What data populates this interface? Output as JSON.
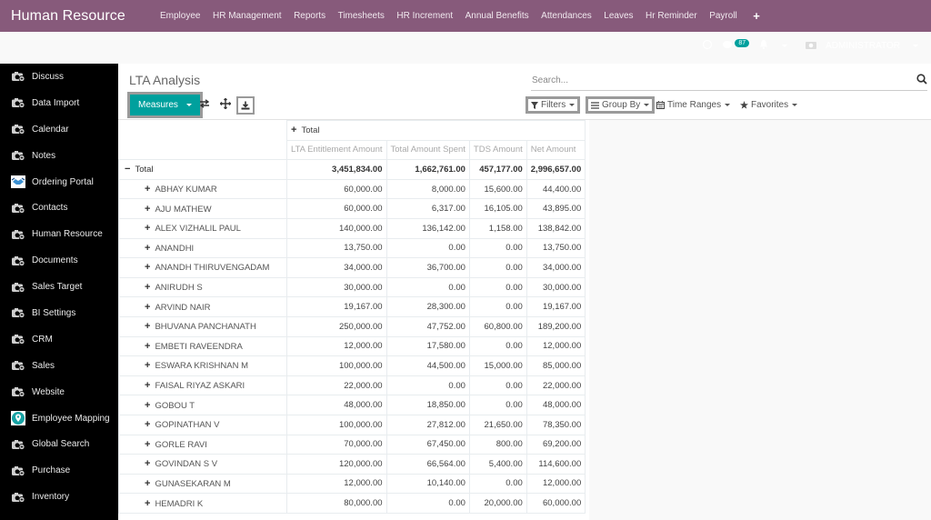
{
  "app": {
    "title": "Human Resource",
    "menu": [
      "Employee",
      "HR Management",
      "Reports",
      "Timesheets",
      "HR Increment",
      "Annual Benefits",
      "Attendances",
      "Leaves",
      "Hr Reminder",
      "Payroll"
    ],
    "add_icon": "plus-icon"
  },
  "systray": {
    "chat_count": "87",
    "user": "ADMINISTRATOR"
  },
  "sidebar": {
    "items": [
      {
        "label": "Discuss",
        "icon": "app-camera-icon"
      },
      {
        "label": "Data Import",
        "icon": "app-camera-icon"
      },
      {
        "label": "Calendar",
        "icon": "app-camera-icon"
      },
      {
        "label": "Notes",
        "icon": "app-camera-icon"
      },
      {
        "label": "Ordering Portal",
        "icon": "handshake-icon"
      },
      {
        "label": "Contacts",
        "icon": "app-camera-icon"
      },
      {
        "label": "Human Resource",
        "icon": "app-camera-icon"
      },
      {
        "label": "Documents",
        "icon": "app-camera-icon"
      },
      {
        "label": "Sales Target",
        "icon": "app-camera-icon"
      },
      {
        "label": "BI Settings",
        "icon": "app-camera-icon"
      },
      {
        "label": "CRM",
        "icon": "app-camera-icon"
      },
      {
        "label": "Sales",
        "icon": "app-camera-icon"
      },
      {
        "label": "Website",
        "icon": "app-camera-icon"
      },
      {
        "label": "Employee Mapping",
        "icon": "map-pin-icon"
      },
      {
        "label": "Global Search",
        "icon": "app-camera-icon"
      },
      {
        "label": "Purchase",
        "icon": "app-camera-icon"
      },
      {
        "label": "Inventory",
        "icon": "app-camera-icon"
      }
    ]
  },
  "control_panel": {
    "title": "LTA Analysis",
    "measures_label": "Measures",
    "search_placeholder": "Search...",
    "filters_label": "Filters",
    "groupby_label": "Group By",
    "timeranges_label": "Time Ranges",
    "favorites_label": "Favorites"
  },
  "pivot": {
    "col_group": "Total",
    "row_group": "Total",
    "measures": [
      "LTA Entitlement Amount",
      "Total Amount Spent",
      "TDS Amount",
      "Net Amount"
    ],
    "totals": [
      "3,451,834.00",
      "1,662,761.00",
      "457,177.00",
      "2,996,657.00"
    ],
    "rows": [
      {
        "name": "ABHAY KUMAR",
        "values": [
          "60,000.00",
          "8,000.00",
          "15,600.00",
          "44,400.00"
        ]
      },
      {
        "name": "AJU MATHEW",
        "values": [
          "60,000.00",
          "6,317.00",
          "16,105.00",
          "43,895.00"
        ]
      },
      {
        "name": "ALEX VIZHALIL PAUL",
        "values": [
          "140,000.00",
          "136,142.00",
          "1,158.00",
          "138,842.00"
        ]
      },
      {
        "name": "ANANDHI",
        "values": [
          "13,750.00",
          "0.00",
          "0.00",
          "13,750.00"
        ]
      },
      {
        "name": "ANANDH THIRUVENGADAM",
        "values": [
          "34,000.00",
          "36,700.00",
          "0.00",
          "34,000.00"
        ]
      },
      {
        "name": "ANIRUDH S",
        "values": [
          "30,000.00",
          "0.00",
          "0.00",
          "30,000.00"
        ]
      },
      {
        "name": "ARVIND NAIR",
        "values": [
          "19,167.00",
          "28,300.00",
          "0.00",
          "19,167.00"
        ]
      },
      {
        "name": "BHUVANA PANCHANATH",
        "values": [
          "250,000.00",
          "47,752.00",
          "60,800.00",
          "189,200.00"
        ]
      },
      {
        "name": "EMBETI RAVEENDRA",
        "values": [
          "12,000.00",
          "17,580.00",
          "0.00",
          "12,000.00"
        ]
      },
      {
        "name": "ESWARA KRISHNAN M",
        "values": [
          "100,000.00",
          "44,500.00",
          "15,000.00",
          "85,000.00"
        ]
      },
      {
        "name": "FAISAL RIYAZ ASKARI",
        "values": [
          "22,000.00",
          "0.00",
          "0.00",
          "22,000.00"
        ]
      },
      {
        "name": "GOBOU T",
        "values": [
          "48,000.00",
          "18,850.00",
          "0.00",
          "48,000.00"
        ]
      },
      {
        "name": "GOPINATHAN V",
        "values": [
          "100,000.00",
          "27,812.00",
          "21,650.00",
          "78,350.00"
        ]
      },
      {
        "name": "GORLE RAVI",
        "values": [
          "70,000.00",
          "67,450.00",
          "800.00",
          "69,200.00"
        ]
      },
      {
        "name": "GOVINDAN S V",
        "values": [
          "120,000.00",
          "66,564.00",
          "5,400.00",
          "114,600.00"
        ]
      },
      {
        "name": "GUNASEKARAN M",
        "values": [
          "12,000.00",
          "10,140.00",
          "0.00",
          "12,000.00"
        ]
      },
      {
        "name": "HEMADRI K",
        "values": [
          "80,000.00",
          "0.00",
          "20,000.00",
          "60,000.00"
        ]
      }
    ]
  },
  "colors": {
    "brand": "#875a7b",
    "primary": "#00a09d"
  }
}
